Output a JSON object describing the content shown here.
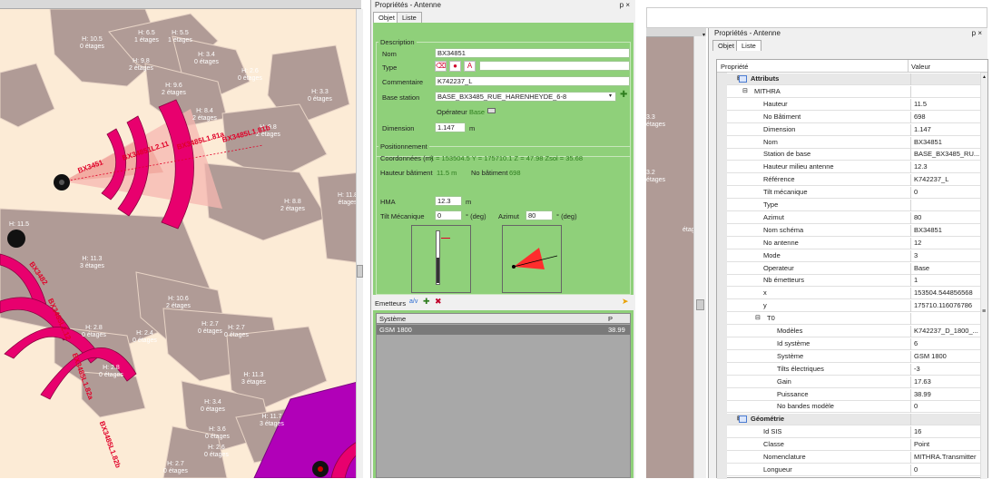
{
  "map": {
    "building_labels": [
      {
        "h": "H: 10.5",
        "e": "0 étages"
      },
      {
        "h": "H: 6.5",
        "e": "1 étages"
      },
      {
        "h": "H: 5.5",
        "e": "1 étages"
      },
      {
        "h": "H: 9.8",
        "e": "2 étages"
      },
      {
        "h": "H: 3.4",
        "e": "0 étages"
      },
      {
        "h": "H: 2.6",
        "e": "0 étages"
      },
      {
        "h": "H: 9.6",
        "e": "2 étages"
      },
      {
        "h": "H: 8.4",
        "e": "2 étages"
      },
      {
        "h": "H: 9.8",
        "e": "2 étages"
      },
      {
        "h": "H: 3.3",
        "e": "0 étages"
      },
      {
        "h": "H: 8.8",
        "e": "2 étages"
      },
      {
        "h": "H: 11.3",
        "e": "3 étages"
      },
      {
        "h": "H: 10.6",
        "e": "2 étages"
      },
      {
        "h": "H: 2.8",
        "e": "0 étages"
      },
      {
        "h": "H: 2.7",
        "e": "0 étages"
      },
      {
        "h": "H: 2.4",
        "e": "0 étages"
      },
      {
        "h": "H: 2.7",
        "e": "0 étages"
      },
      {
        "h": "H: 2.8",
        "e": "0 étages"
      },
      {
        "h": "H: 11.3",
        "e": "3 étages"
      },
      {
        "h": "H: 3.4",
        "e": "0 étages"
      },
      {
        "h": "H: 11.7",
        "e": "3 étages"
      },
      {
        "h": "H: 3.6",
        "e": "0 étages"
      },
      {
        "h": "H: 2.6",
        "e": "0 étages"
      },
      {
        "h": "H: 2.7",
        "e": "0 étages"
      },
      {
        "h": "H: 11.5",
        "e": ""
      },
      {
        "h": "H: 11.8",
        "e": "étages"
      }
    ],
    "antenna_labels": [
      "BX3451",
      "BX34851L2.11",
      "BX3485L1.81a",
      "BX3485L1.81b",
      "BX3482",
      "BX3485L2.12",
      "BX3485L1.82a",
      "BX3485L1.82b"
    ]
  },
  "panel": {
    "title": "Propriétés - Antenne",
    "pin": "p ×",
    "tabs": [
      "Objet",
      "Liste"
    ],
    "description_legend": "Description",
    "nom_label": "Nom",
    "nom_value": "BX34851",
    "type_label": "Type",
    "commentaire_label": "Commentaire",
    "commentaire_value": "K742237_L",
    "base_station_label": "Base station",
    "base_station_value": "BASE_BX3485_RUE_HARENHEYDE_6-8",
    "operateur_label": "Opérateur",
    "operateur_value": "Base",
    "dimension_label": "Dimension",
    "dimension_value": "1.147",
    "dimension_unit": "m",
    "positionnement_legend": "Positionnement",
    "coords_label": "Coordonnées (m)",
    "coords_value": "X = 153504.5   Y = 175710.1   Z = 47.98   Zsol = 35.68",
    "hauteur_bat_label": "Hauteur bâtiment",
    "hauteur_bat_value": "11.5 m",
    "no_bat_label": "No bâtiment",
    "no_bat_value": "698",
    "hma_label": "HMA",
    "hma_value": "12.3",
    "hma_unit": "m",
    "tilt_label": "Tilt Mécanique",
    "tilt_value": "0",
    "tilt_unit": "° (deg)",
    "azimut_label": "Azimut",
    "azimut_value": "80",
    "azimut_unit": "° (deg)",
    "emetteurs_label": "Emetteurs",
    "table_headers": [
      "Système",
      "P"
    ],
    "table_rows": [
      {
        "systeme": "GSM 1800",
        "p": "38.99"
      }
    ]
  },
  "right": {
    "title": "Propriétés - Antenne",
    "pin": "p ×",
    "tabs": [
      "Objet",
      "Liste"
    ],
    "headers": [
      "Propriété",
      "Valeur"
    ],
    "side_labels": [
      "3.3",
      "étages",
      "3.2",
      "étages",
      "étages"
    ],
    "rows": [
      {
        "k": "Attributs",
        "v": "",
        "type": "cat"
      },
      {
        "k": "MITHRA",
        "v": "",
        "type": "group"
      },
      {
        "k": "Hauteur",
        "v": "11.5"
      },
      {
        "k": "No Bâtiment",
        "v": "698"
      },
      {
        "k": "Dimension",
        "v": "1.147"
      },
      {
        "k": "Nom",
        "v": "BX34851"
      },
      {
        "k": "Station de base",
        "v": "BASE_BX3485_RU..."
      },
      {
        "k": "Hauteur milieu antenne",
        "v": "12.3"
      },
      {
        "k": "Référence",
        "v": "K742237_L"
      },
      {
        "k": "Tilt mécanique",
        "v": "0"
      },
      {
        "k": "Type",
        "v": ""
      },
      {
        "k": "Azimut",
        "v": "80"
      },
      {
        "k": "Nom schéma",
        "v": "BX34851"
      },
      {
        "k": "No antenne",
        "v": "12"
      },
      {
        "k": "Mode",
        "v": "3"
      },
      {
        "k": "Operateur",
        "v": "Base"
      },
      {
        "k": "Nb émetteurs",
        "v": "1"
      },
      {
        "k": "x",
        "v": "153504.544856568"
      },
      {
        "k": "y",
        "v": "175710.116076786"
      },
      {
        "k": "T0",
        "v": "",
        "type": "group2"
      },
      {
        "k": "Modèles",
        "v": "K742237_D_1800_..."
      },
      {
        "k": "Id système",
        "v": "6"
      },
      {
        "k": "Système",
        "v": "GSM 1800"
      },
      {
        "k": "Tilts électriques",
        "v": "-3"
      },
      {
        "k": "Gain",
        "v": "17.63"
      },
      {
        "k": "Puissance",
        "v": "38.99"
      },
      {
        "k": "No bandes modèle",
        "v": "0"
      },
      {
        "k": "Géométrie",
        "v": "",
        "type": "cat"
      },
      {
        "k": "Id SIS",
        "v": "16"
      },
      {
        "k": "Classe",
        "v": "Point"
      },
      {
        "k": "Nomenclature",
        "v": "MITHRA.Transmitter"
      },
      {
        "k": "Longueur",
        "v": "0"
      }
    ]
  },
  "colors": {
    "panel_green": "#8fd07a",
    "antenna": "#e8006e",
    "building": "#b09b96",
    "background": "#fcebd6"
  }
}
